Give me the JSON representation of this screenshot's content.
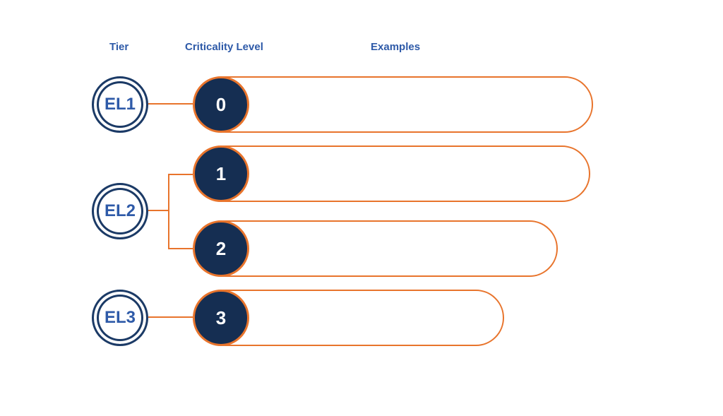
{
  "headers": {
    "tier": "Tier",
    "criticality": "Criticality Level",
    "examples": "Examples"
  },
  "tiers": {
    "el1": "EL1",
    "el2": "EL2",
    "el3": "EL3"
  },
  "criticality": {
    "level0": "0",
    "level1": "1",
    "level2": "2",
    "level3": "3"
  },
  "examples": {
    "row0": "",
    "row1": "",
    "row2": "",
    "row3": ""
  },
  "colors": {
    "navy": "#1b3a66",
    "orange": "#e8742c",
    "blueText": "#2e5aa8"
  }
}
